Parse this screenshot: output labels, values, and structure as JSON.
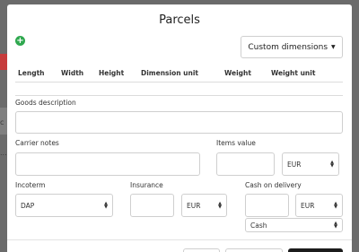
{
  "modal": {
    "title": "Parcels",
    "custom_dimensions_label": "Custom dimensions"
  },
  "table": {
    "columns": [
      "Length",
      "Width",
      "Height",
      "Dimension unit",
      "Weight",
      "Weight unit"
    ]
  },
  "form": {
    "goods_description_label": "Goods description",
    "goods_description_value": "",
    "carrier_notes_label": "Carrier notes",
    "carrier_notes_value": "",
    "items_value_label": "Items value",
    "items_value_value": "",
    "items_value_currency": "EUR",
    "incoterm_label": "Incoterm",
    "incoterm_value": "DAP",
    "insurance_label": "Insurance",
    "insurance_value": "",
    "insurance_currency": "EUR",
    "cod_label": "Cash on delivery",
    "cod_value": "",
    "cod_currency": "EUR",
    "cod_method": "Cash"
  },
  "icons": {
    "add": "plus-circle-icon",
    "dropdown": "caret-down-icon",
    "select_arrows": "up-down-arrows-icon"
  },
  "colors": {
    "add_icon": "#2fa84f",
    "overlay": "#6b6b6b",
    "primary_button": "#1c1c1c"
  }
}
